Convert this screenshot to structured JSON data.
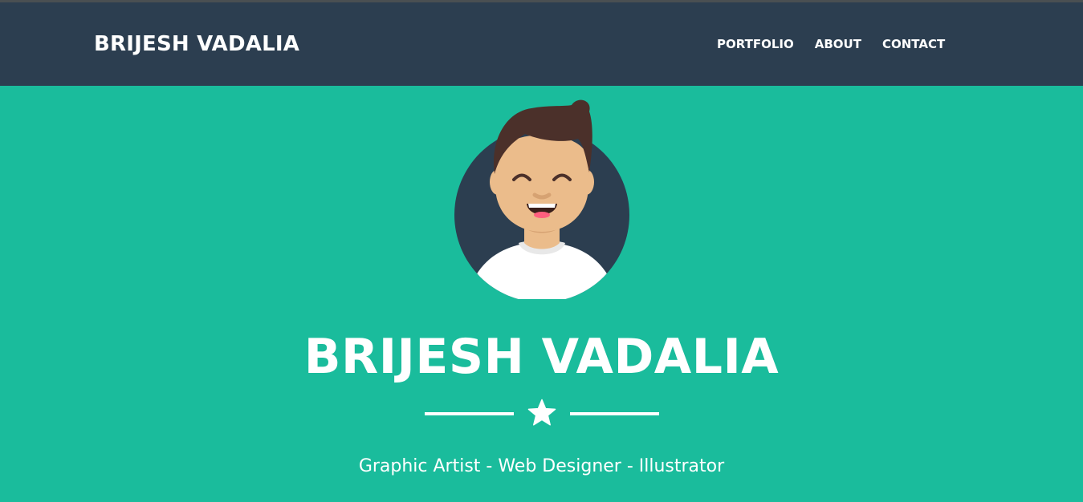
{
  "navbar": {
    "brand": "BRIJESH VADALIA",
    "links": [
      "PORTFOLIO",
      "ABOUT",
      "CONTACT"
    ]
  },
  "hero": {
    "title": "BRIJESH VADALIA",
    "subtitle": "Graphic Artist - Web Designer - Illustrator",
    "divider_icon": "star-icon",
    "avatar_icon": "avatar-illustration"
  },
  "colors": {
    "navbar_bg": "#2c3e50",
    "masthead_bg": "#1abc9c",
    "text": "#ffffff",
    "avatar_circle": "#2c3e50",
    "skin": "#ebbc8b",
    "hair": "#4b302a"
  }
}
